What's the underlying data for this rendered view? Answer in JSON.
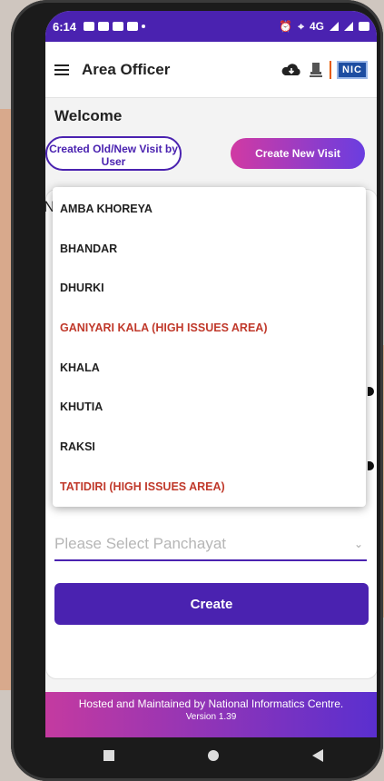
{
  "status_bar": {
    "time": "6:14",
    "network": "4G"
  },
  "app_bar": {
    "title": "Area Officer",
    "icons": [
      "menu-icon",
      "cloud-download-icon",
      "national-emblem-icon",
      "nic-logo"
    ],
    "nic_label": "NIC"
  },
  "main": {
    "welcome": "Welcome",
    "created_visits_button": "Created Old/New Visit by User",
    "create_new_visit_button": "Create New Visit",
    "card_peek_letter": "N",
    "dropdown_options": [
      {
        "label": "AMBA KHOREYA",
        "high_issue": false
      },
      {
        "label": "BHANDAR",
        "high_issue": false
      },
      {
        "label": "DHURKI",
        "high_issue": false
      },
      {
        "label": "GANIYARI KALA (HIGH ISSUES AREA)",
        "high_issue": true
      },
      {
        "label": "KHALA",
        "high_issue": false
      },
      {
        "label": "KHUTIA",
        "high_issue": false
      },
      {
        "label": "RAKSI",
        "high_issue": false
      },
      {
        "label": "TATIDIRI (HIGH ISSUES AREA)",
        "high_issue": true
      }
    ],
    "panchayat_placeholder": "Please Select Panchayat",
    "create_button": "Create"
  },
  "footer": {
    "line1": "Hosted and Maintained by National Informatics Centre.",
    "line2": "Version 1.39"
  },
  "colors": {
    "primary": "#4a22b0",
    "accent_gradient_start": "#d13aa3",
    "accent_gradient_end": "#6a3de0",
    "high_issue_text": "#c0392b"
  }
}
